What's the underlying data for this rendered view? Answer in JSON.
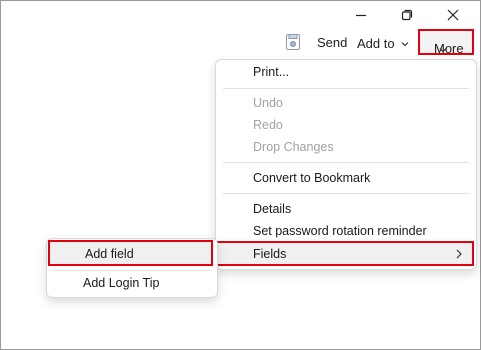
{
  "toolbar": {
    "send_label": "Send",
    "add_to_label": "Add to",
    "more_label": "More"
  },
  "more_menu": {
    "items": [
      {
        "label": "Print...",
        "enabled": true
      },
      {
        "label": "Undo",
        "enabled": false
      },
      {
        "label": "Redo",
        "enabled": false
      },
      {
        "label": "Drop Changes",
        "enabled": false
      },
      {
        "label": "Convert to Bookmark",
        "enabled": true
      },
      {
        "label": "Details",
        "enabled": true
      },
      {
        "label": "Set password rotation reminder",
        "enabled": true
      },
      {
        "label": "Fields",
        "enabled": true,
        "submenu": true
      }
    ]
  },
  "fields_submenu": {
    "items": [
      {
        "label": "Add field"
      },
      {
        "label": "Add Login Tip"
      }
    ]
  },
  "colors": {
    "highlight_border": "#e3000f",
    "disabled_text": "#a2a2a2"
  },
  "icons": [
    "minimize-icon",
    "restore-icon",
    "close-icon",
    "save-icon",
    "chevron-down-icon",
    "chevron-right-icon"
  ]
}
